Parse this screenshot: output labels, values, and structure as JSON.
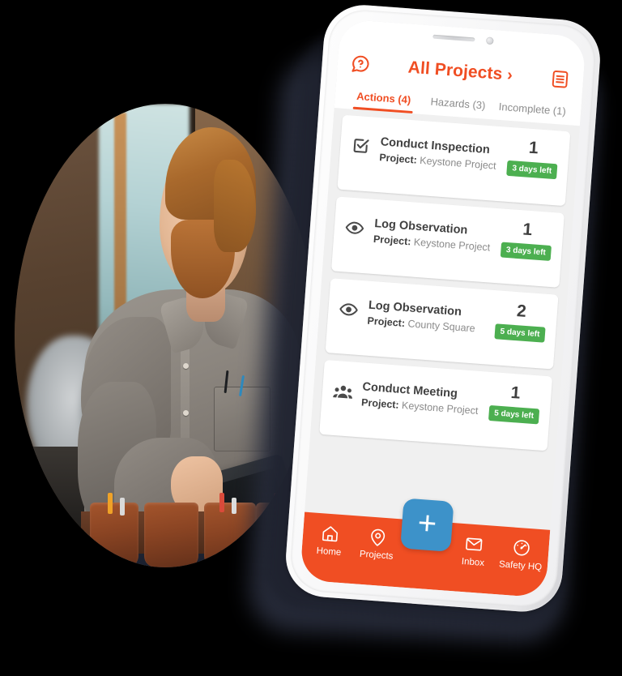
{
  "app": {
    "header": {
      "help_icon": "question-speech-bubble-icon",
      "title": "All Projects",
      "chevron": "›",
      "list_icon": "list-document-icon"
    },
    "tabs": [
      {
        "label": "Actions (4)",
        "active": true
      },
      {
        "label": "Hazards (3)",
        "active": false
      },
      {
        "label": "Incomplete (1)",
        "active": false
      }
    ],
    "cards": [
      {
        "icon": "checkbox-checked-icon",
        "title": "Conduct Inspection",
        "project_label": "Project:",
        "project_name": "Keystone Project",
        "count": "1",
        "badge": "3 days left"
      },
      {
        "icon": "eye-icon",
        "title": "Log Observation",
        "project_label": "Project:",
        "project_name": "Keystone Project",
        "count": "1",
        "badge": "3 days left"
      },
      {
        "icon": "eye-icon",
        "title": "Log Observation",
        "project_label": "Project:",
        "project_name": "County Square",
        "count": "2",
        "badge": "5 days left"
      },
      {
        "icon": "people-group-icon",
        "title": "Conduct Meeting",
        "project_label": "Project:",
        "project_name": "Keystone Project",
        "count": "1",
        "badge": "5 days left"
      }
    ],
    "bottom_nav": {
      "items": [
        {
          "icon": "home-icon",
          "label": "Home"
        },
        {
          "icon": "map-pin-icon",
          "label": "Projects"
        },
        {
          "icon": "envelope-icon",
          "label": "Inbox"
        },
        {
          "icon": "gauge-icon",
          "label": "Safety HQ"
        }
      ],
      "fab": {
        "icon": "plus-icon",
        "label": "+"
      }
    }
  },
  "colors": {
    "brand_orange": "#f04e23",
    "badge_green": "#4caf50",
    "fab_blue": "#3d92c9",
    "app_bg": "#f0f0f0",
    "card_bg": "#ffffff",
    "page_bg": "#000000"
  },
  "photo": {
    "alt": "worker-with-tablet-photo"
  }
}
